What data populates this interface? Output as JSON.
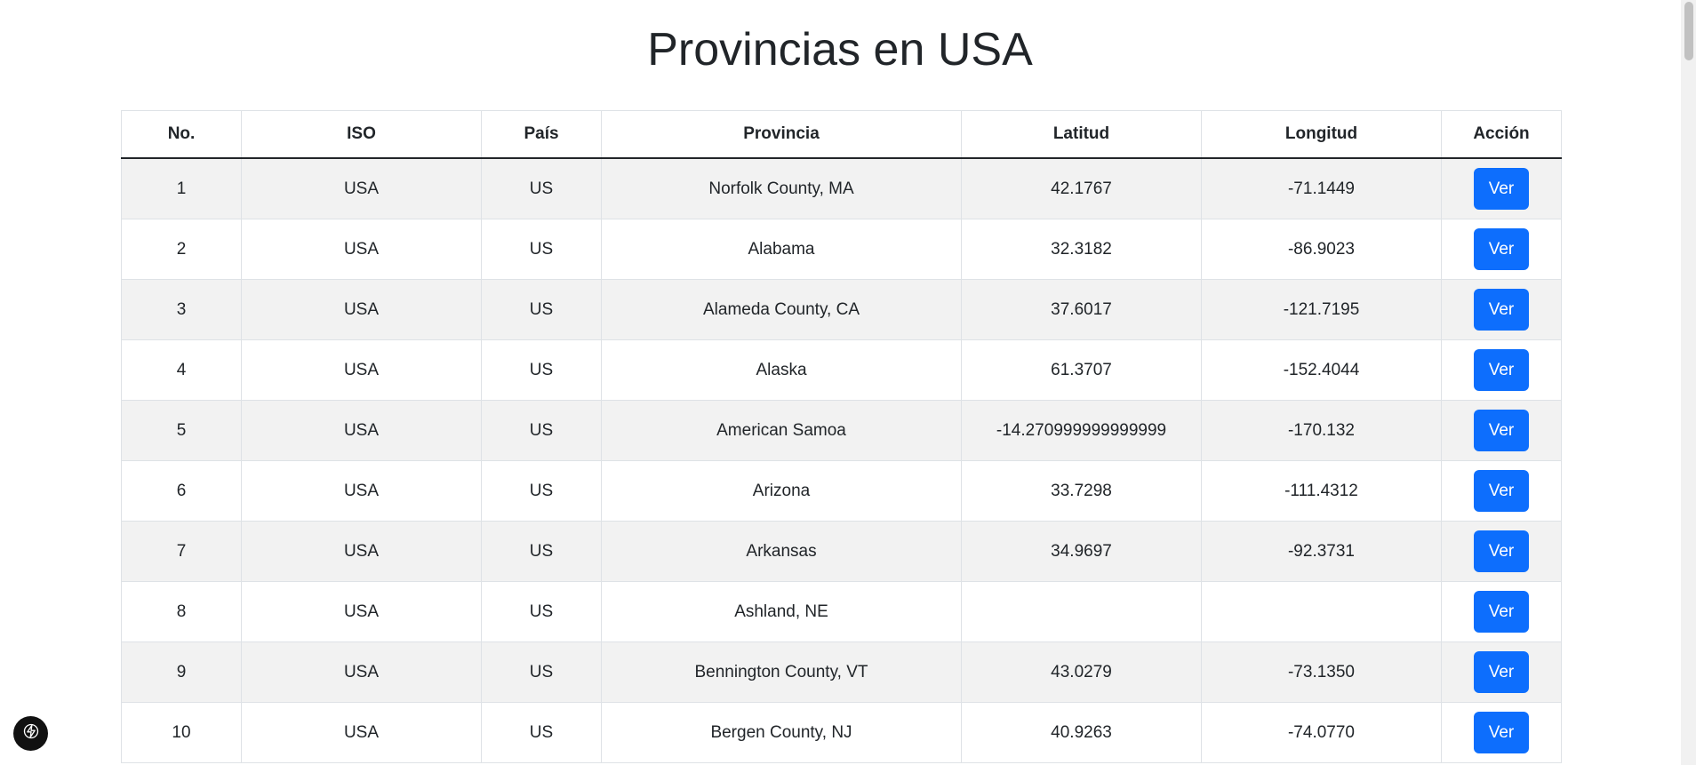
{
  "page": {
    "title": "Provincias en USA"
  },
  "table": {
    "headers": {
      "no": "No.",
      "iso": "ISO",
      "pais": "País",
      "provincia": "Provincia",
      "latitud": "Latitud",
      "longitud": "Longitud",
      "accion": "Acción"
    },
    "action_label": "Ver",
    "rows": [
      {
        "no": "1",
        "iso": "USA",
        "pais": "US",
        "provincia": "Norfolk County, MA",
        "latitud": "42.1767",
        "longitud": "-71.1449"
      },
      {
        "no": "2",
        "iso": "USA",
        "pais": "US",
        "provincia": "Alabama",
        "latitud": "32.3182",
        "longitud": "-86.9023"
      },
      {
        "no": "3",
        "iso": "USA",
        "pais": "US",
        "provincia": "Alameda County, CA",
        "latitud": "37.6017",
        "longitud": "-121.7195"
      },
      {
        "no": "4",
        "iso": "USA",
        "pais": "US",
        "provincia": "Alaska",
        "latitud": "61.3707",
        "longitud": "-152.4044"
      },
      {
        "no": "5",
        "iso": "USA",
        "pais": "US",
        "provincia": "American Samoa",
        "latitud": "-14.270999999999999",
        "longitud": "-170.132"
      },
      {
        "no": "6",
        "iso": "USA",
        "pais": "US",
        "provincia": "Arizona",
        "latitud": "33.7298",
        "longitud": "-111.4312"
      },
      {
        "no": "7",
        "iso": "USA",
        "pais": "US",
        "provincia": "Arkansas",
        "latitud": "34.9697",
        "longitud": "-92.3731"
      },
      {
        "no": "8",
        "iso": "USA",
        "pais": "US",
        "provincia": "Ashland, NE",
        "latitud": "",
        "longitud": ""
      },
      {
        "no": "9",
        "iso": "USA",
        "pais": "US",
        "provincia": "Bennington County, VT",
        "latitud": "43.0279",
        "longitud": "-73.1350"
      },
      {
        "no": "10",
        "iso": "USA",
        "pais": "US",
        "provincia": "Bergen County, NJ",
        "latitud": "40.9263",
        "longitud": "-74.0770"
      }
    ]
  },
  "colors": {
    "button_bg": "#0d6efd",
    "stripe_bg": "#f2f2f2",
    "fab_bg": "#111111"
  },
  "icons": {
    "fab": "lightning-bolt-icon"
  }
}
